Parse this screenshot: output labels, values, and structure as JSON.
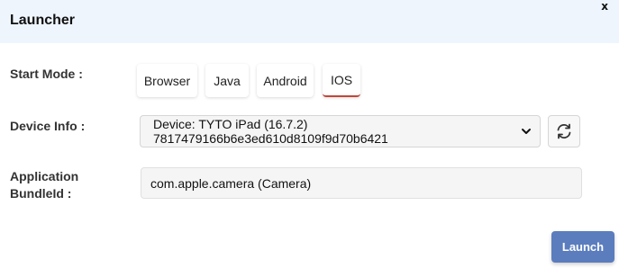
{
  "dialog": {
    "title": "Launcher",
    "close_label": "x"
  },
  "start_mode": {
    "label": "Start Mode :",
    "options": [
      "Browser",
      "Java",
      "Android",
      "IOS"
    ],
    "selected": "IOS"
  },
  "device_info": {
    "label": "Device Info :",
    "selected_value": "Device: TYTO iPad (16.7.2) 7817479166b6e3ed610d8109f9d70b6421",
    "refresh_icon": "refresh-icon"
  },
  "application_bundle": {
    "label_line1": "Application",
    "label_line2": "BundleId :",
    "value": "com.apple.camera (Camera)"
  },
  "footer": {
    "launch_label": "Launch"
  },
  "colors": {
    "header_bg": "#eef5fd",
    "active_tab_underline": "#c0473a",
    "launch_button": "#5b7dbe"
  }
}
